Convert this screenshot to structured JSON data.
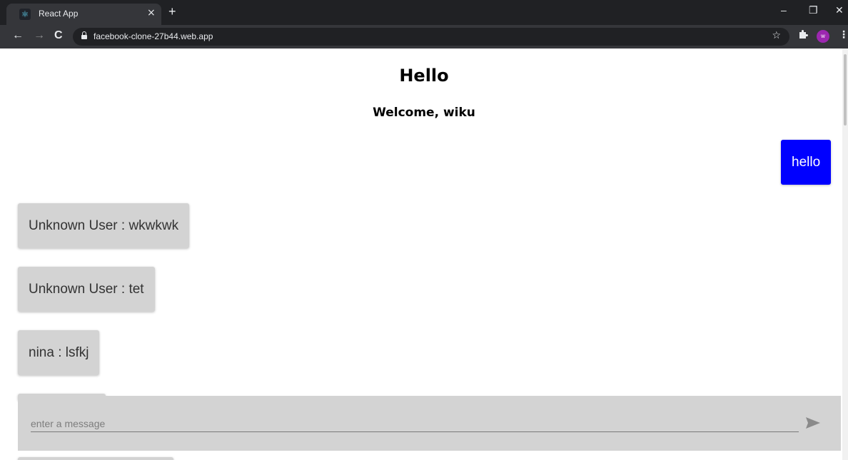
{
  "browser": {
    "tab_title": "React App",
    "tab_close": "×",
    "new_tab": "+",
    "url": "facebook-clone-27b44.web.app",
    "avatar_initial": "w",
    "window_controls": {
      "minimize": "–",
      "restore": "❐",
      "close": "✕"
    }
  },
  "page": {
    "title": "Hello",
    "subtitle": "Welcome, wiku"
  },
  "messages": [
    {
      "text": "hello",
      "from_me": true
    },
    {
      "text": "Unknown User : wkwkwk",
      "from_me": false
    },
    {
      "text": "Unknown User : tet",
      "from_me": false
    },
    {
      "text": "nina : lsfkj",
      "from_me": false
    }
  ],
  "composer": {
    "placeholder": "enter a message",
    "value": ""
  },
  "colors": {
    "my_message_bg": "#0000ff",
    "other_message_bg": "#d3d3d3",
    "composer_bg": "#d3d3d3"
  }
}
